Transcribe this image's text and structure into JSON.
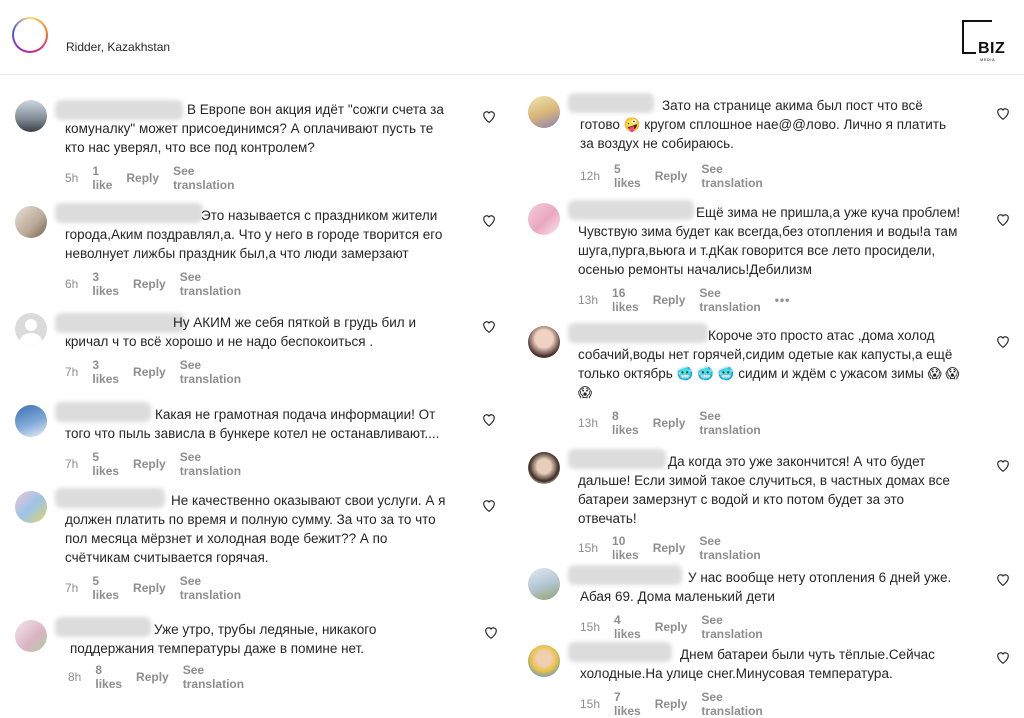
{
  "header": {
    "location": "Ridder, Kazakhstan",
    "logo_text": "BIZ",
    "logo_subtext": "MEDIA"
  },
  "comments_left": [
    {
      "text": "В Европе вон акция идёт \"сожги счета за\nкомуналку\" может присоединимся? А оплачивают пусть те\nкто нас уверял, что все под контролем?",
      "time": "5h",
      "likes": "1 like",
      "reply": "Reply",
      "translation": "See translation"
    },
    {
      "text": "Это называется с праздником жители\nгорода,Аким поздравлял,а. Что у него в городе творится его\nневолнует лижбы праздник был,а что люди замерзают",
      "time": "6h",
      "likes": "3 likes",
      "reply": "Reply",
      "translation": "See translation"
    },
    {
      "text": "Ну АКИМ же себя пяткой в грудь бил и\nкричал ч то всё хорошо и не надо беспокоиться .",
      "time": "7h",
      "likes": "3 likes",
      "reply": "Reply",
      "translation": "See translation"
    },
    {
      "text": "Какая не грамотная подача информации! От\nтого что пыль зависла в бункере котел не останавливают....",
      "time": "7h",
      "likes": "5 likes",
      "reply": "Reply",
      "translation": "See translation"
    },
    {
      "text": "Не качественно оказывают свои услуги. А я\nдолжен платить по время и полную сумму. За что за то что\nпол месяца мёрзнет и холодная воде бежит?? А по\nсчётчикам считывается горячая.",
      "time": "7h",
      "likes": "5 likes",
      "reply": "Reply",
      "translation": "See translation"
    },
    {
      "text": "Уже утро, трубы ледяные, никакого\nподдержания температуры даже в помине нет.",
      "time": "8h",
      "likes": "8 likes",
      "reply": "Reply",
      "translation": "See translation"
    }
  ],
  "comments_right": [
    {
      "text": "Зато на странице акима был пост что всё\nготово 🤪 кругом сплошное нае@@лово. Лично я платить\nза воздух не собираюсь.",
      "time": "12h",
      "likes": "5 likes",
      "reply": "Reply",
      "translation": "See translation"
    },
    {
      "text": "Ещё зима не пришла,а уже куча проблем!\nЧувствую зима будет как всегда,без отопления и воды!а там\nшуга,пурга,вьюга и т.дКак говорится все лето просидели,\nосенью ремонты начались!Дебилизм",
      "time": "13h",
      "likes": "16 likes",
      "reply": "Reply",
      "translation": "See translation",
      "more": "•••"
    },
    {
      "text": "Короче это просто атас ,дома холод\nсобачий,воды нет горячей,сидим одетые как капусты,а ещё\nтолько октябрь 🥶 🥶 🥶 сидим и ждём с ужасом зимы 😱 😱\n😱",
      "time": "13h",
      "likes": "8 likes",
      "reply": "Reply",
      "translation": "See translation"
    },
    {
      "text": "Да когда это уже закончится! А что будет\nдальше! Если зимой такое случиться, в частных домах все\nбатареи замерзнут с водой и кто потом будет за это\nотвечать!",
      "time": "15h",
      "likes": "10 likes",
      "reply": "Reply",
      "translation": "See translation"
    },
    {
      "text": "У нас вообще нету отопления 6 дней уже.\nАбая 69. Дома маленький дети",
      "time": "15h",
      "likes": "4 likes",
      "reply": "Reply",
      "translation": "See translation"
    },
    {
      "text": "Днем батареи были чуть тёплые.Сейчас\nхолодные.На улице снег.Минусовая температура.",
      "time": "15h",
      "likes": "7 likes",
      "reply": "Reply",
      "translation": "See translation"
    }
  ],
  "colors": {
    "meta": "#8e8e8e",
    "text": "#262626",
    "divider": "#efefef"
  }
}
